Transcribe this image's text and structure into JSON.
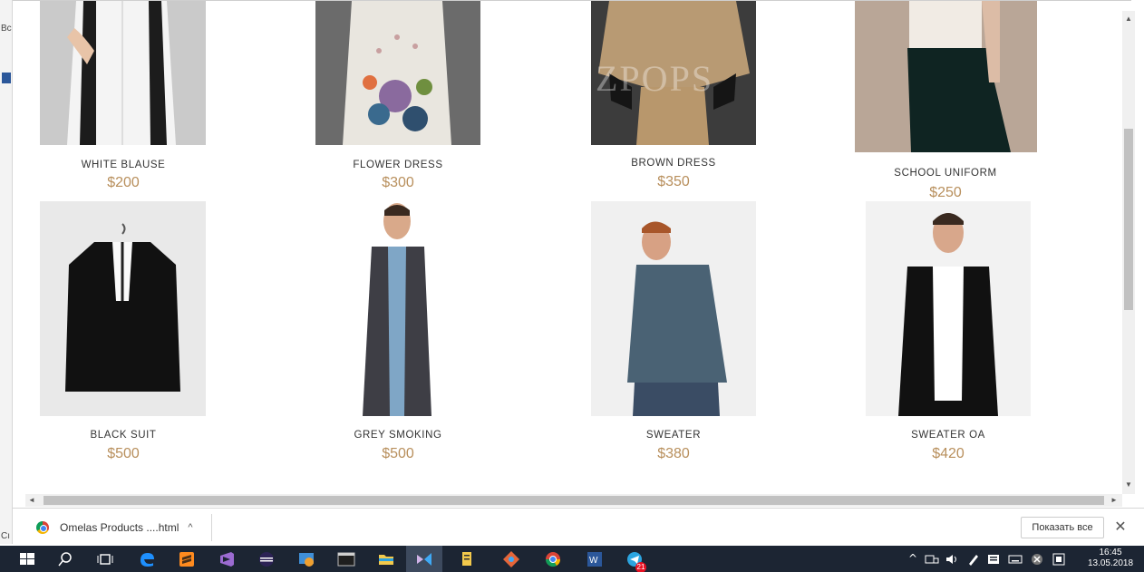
{
  "background_app": {
    "label_top": "Bc",
    "label_bottom": "Cı"
  },
  "products": [
    {
      "name": "WHITE BLAUSE",
      "price": "$200"
    },
    {
      "name": "FLOWER DRESS",
      "price": "$300"
    },
    {
      "name": "BROWN DRESS",
      "price": "$350",
      "watermark": "ZPOPS"
    },
    {
      "name": "SCHOOL UNIFORM",
      "price": "$250"
    },
    {
      "name": "BLACK SUIT",
      "price": "$500"
    },
    {
      "name": "GREY SMOKING",
      "price": "$500"
    },
    {
      "name": "SWEATER",
      "price": "$380"
    },
    {
      "name": "SWEATER OA",
      "price": "$420"
    }
  ],
  "download_bar": {
    "file_name": "Omelas Products ....html",
    "show_all_label": "Показать все",
    "close_label": "✕",
    "chevron": "^"
  },
  "scrollbars": {
    "up": "▲",
    "down": "▼",
    "left": "◄",
    "right": "►"
  },
  "taskbar": {
    "clock_time": "16:45",
    "clock_date": "13.05.2018",
    "notification_badge": "21",
    "tray_chevron": "^"
  },
  "colors": {
    "price": "#b88f5c",
    "taskbar": "#1c2533"
  }
}
